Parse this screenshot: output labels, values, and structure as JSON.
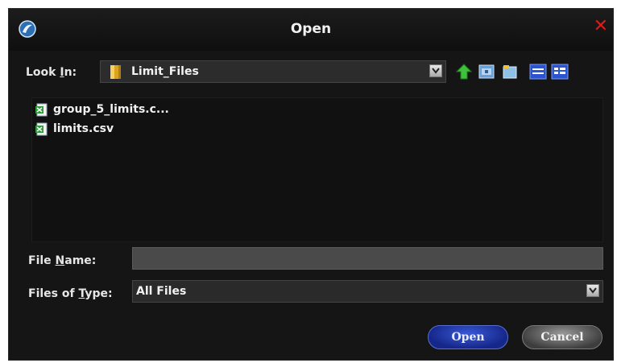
{
  "window": {
    "title": "Open"
  },
  "look_in": {
    "label_pre": "Look ",
    "label_key": "I",
    "label_post": "n:",
    "value": "Limit_Files"
  },
  "toolbar": {
    "icons": [
      "up-folder-icon",
      "desktop-icon",
      "new-folder-icon",
      "list-view-icon",
      "details-view-icon"
    ]
  },
  "files": [
    {
      "name": "group_5_limits.c...",
      "icon": "spreadsheet-icon"
    },
    {
      "name": "limits.csv",
      "icon": "spreadsheet-icon"
    }
  ],
  "file_name": {
    "label_pre": "File ",
    "label_key": "N",
    "label_post": "ame:",
    "value": ""
  },
  "file_type": {
    "label_pre": "Files of ",
    "label_key": "T",
    "label_post": "ype:",
    "value": "All Files"
  },
  "buttons": {
    "open": "Open",
    "cancel": "Cancel"
  },
  "colors": {
    "open_button": "#1a2f9a",
    "close_x": "#e01919",
    "background": "#151515"
  }
}
